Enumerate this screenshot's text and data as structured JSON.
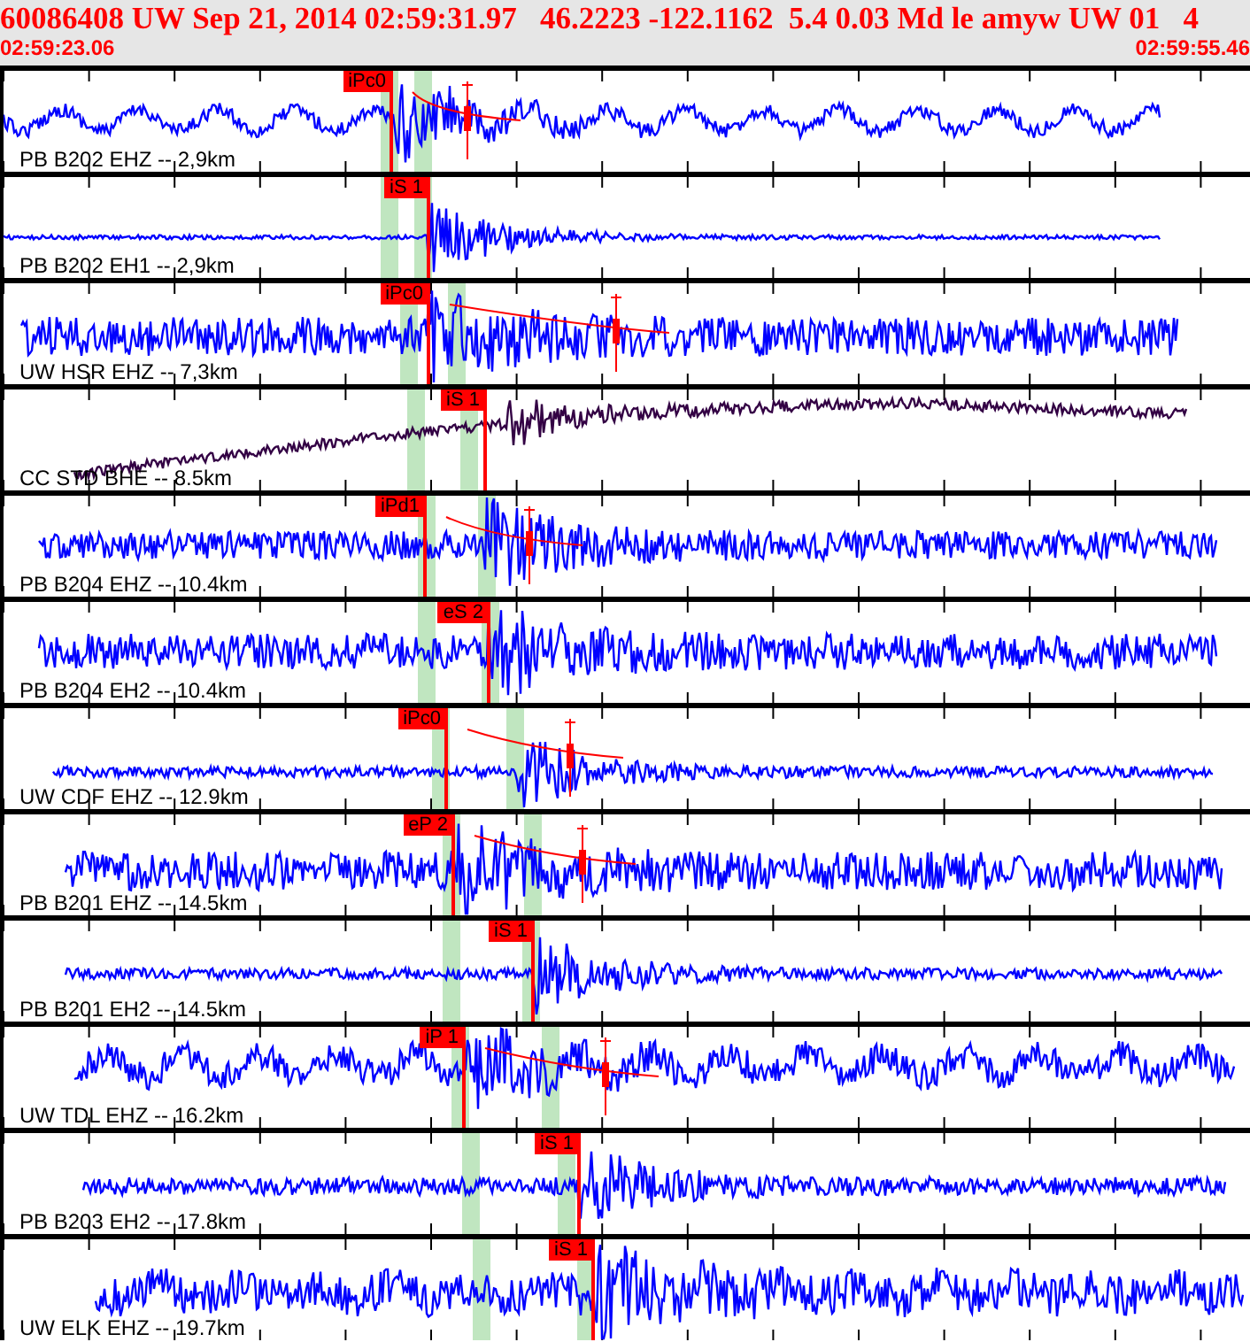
{
  "header": {
    "title": "60086408 UW Sep 21, 2014 02:59:31.97   46.2223 -122.1162  5.4 0.03 Md le amyw UW 01   4",
    "start_time": "02:59:23.06",
    "end_time": "02:59:55.46"
  },
  "traces": [
    {
      "station": "PB B202 EHZ -- 2,9km",
      "pick": "iPc0",
      "color": "#0000ff"
    },
    {
      "station": "PB B202 EH1 -- 2,9km",
      "pick": "iS 1",
      "color": "#0000ff"
    },
    {
      "station": "UW HSR EHZ -- 7,3km",
      "pick": "iPc0",
      "color": "#0000ff"
    },
    {
      "station": "CC STD BHE -- 8.5km",
      "pick": "iS 1",
      "color": "#330044"
    },
    {
      "station": "PB B204 EHZ -- 10.4km",
      "pick": "iPd1",
      "color": "#0000ff"
    },
    {
      "station": "PB B204 EH2 -- 10.4km",
      "pick": "eS 2",
      "color": "#0000ff"
    },
    {
      "station": "UW CDF EHZ -- 12.9km",
      "pick": "iPc0",
      "color": "#0000ff"
    },
    {
      "station": "PB B201 EHZ -- 14.5km",
      "pick": "eP 2",
      "color": "#0000ff"
    },
    {
      "station": "PB B201 EH2 -- 14.5km",
      "pick": "iS 1",
      "color": "#0000ff"
    },
    {
      "station": "UW TDL EHZ -- 16.2km",
      "pick": "iP 1",
      "color": "#0000ff"
    },
    {
      "station": "PB B203 EH2 -- 17.8km",
      "pick": "iS 1",
      "color": "#0000ff"
    },
    {
      "station": "UW ELK EHZ -- 19.7km",
      "pick": "iS 1",
      "color": "#0000ff"
    }
  ]
}
